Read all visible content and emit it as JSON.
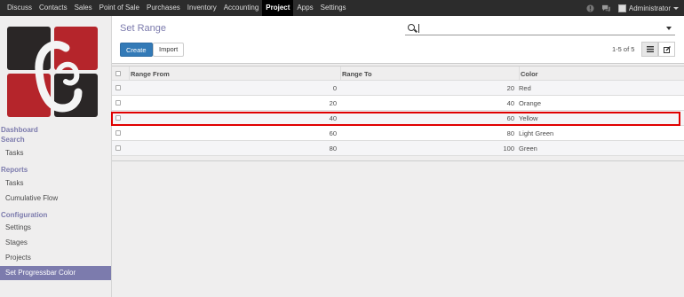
{
  "topbar": {
    "menu": [
      "Discuss",
      "Contacts",
      "Sales",
      "Point of Sale",
      "Purchases",
      "Inventory",
      "Accounting",
      "Project",
      "Apps",
      "Settings"
    ],
    "active": "Project",
    "user": "Administrator"
  },
  "sidebar": {
    "dashboard": "Dashboard",
    "search": "Search",
    "tasks1": "Tasks",
    "reports": "Reports",
    "tasks2": "Tasks",
    "cumulative": "Cumulative Flow",
    "configuration": "Configuration",
    "settings": "Settings",
    "stages": "Stages",
    "projects": "Projects",
    "progressbar": "Set Progressbar Color"
  },
  "control_panel": {
    "title": "Set Range",
    "create": "Create",
    "import": "Import",
    "search_value": "",
    "pager": "1-5 of 5"
  },
  "table": {
    "headers": {
      "from": "Range From",
      "to": "Range To",
      "color": "Color"
    },
    "rows": [
      {
        "from": "0",
        "to": "20",
        "color": "Red"
      },
      {
        "from": "20",
        "to": "40",
        "color": "Orange"
      },
      {
        "from": "40",
        "to": "60",
        "color": "Yellow"
      },
      {
        "from": "60",
        "to": "80",
        "color": "Light Green"
      },
      {
        "from": "80",
        "to": "100",
        "color": "Green"
      }
    ]
  },
  "colors": {
    "brand": "#7c7bad",
    "primary": "#337ab7",
    "highlight": "#e00000",
    "logo_red": "#b5252b",
    "logo_dark": "#2a2626"
  },
  "icons": [
    "search-icon",
    "dropdown-caret-icon",
    "list-view-icon",
    "edit-view-icon",
    "chat-icon",
    "notification-icon"
  ]
}
